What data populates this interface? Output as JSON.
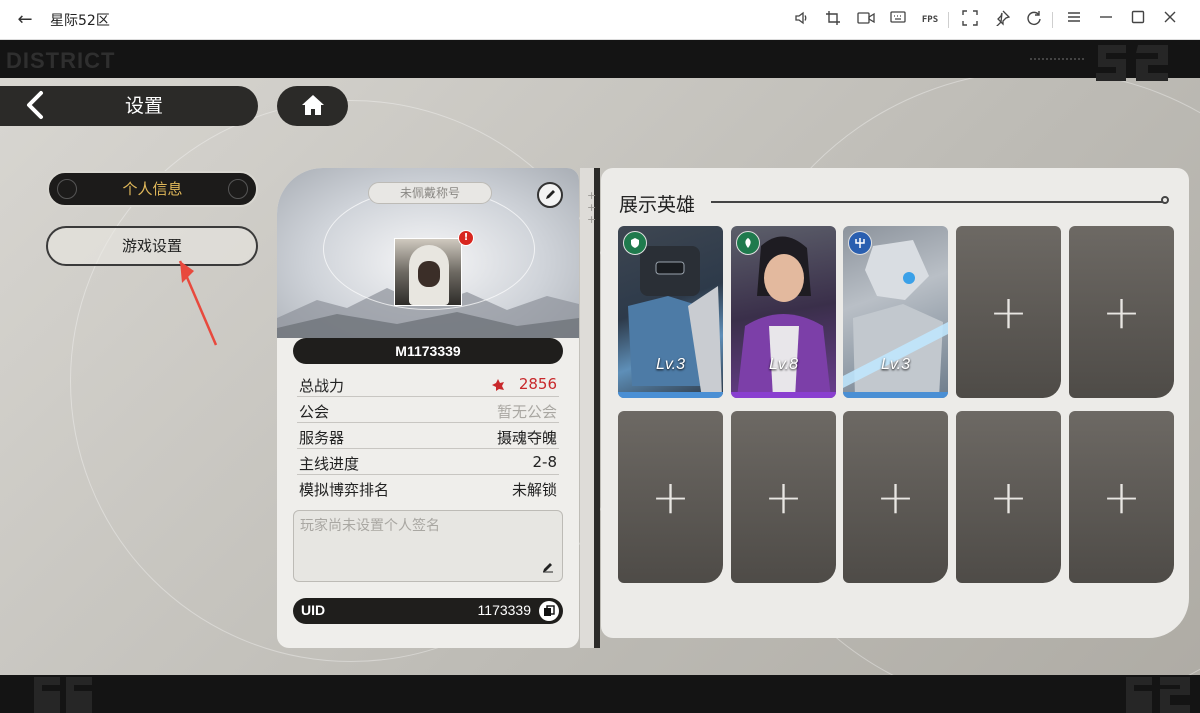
{
  "window": {
    "title": "星际52区",
    "back_icon": "back-arrow-icon",
    "toolbar_icons": [
      "volume-icon",
      "crop-icon",
      "record-icon",
      "keyboard-icon",
      "fps-icon",
      "fullscreen-icon",
      "pin-icon",
      "rotate-icon",
      "menu-icon",
      "minimize-icon",
      "maximize-icon",
      "close-icon"
    ],
    "fps_label": "FPS"
  },
  "game": {
    "district_text": "DISTRICT",
    "header": {
      "title": "设置",
      "back_icon": "chevron-left-icon",
      "home_icon": "home-icon"
    },
    "menu": {
      "items": [
        {
          "label": "个人信息",
          "active": true
        },
        {
          "label": "游戏设置",
          "active": false
        }
      ]
    },
    "profile": {
      "title_badge": "未佩戴称号",
      "edit_icon": "pencil-icon",
      "alert_mark": "!",
      "player_name": "M1173339",
      "stats": [
        {
          "label": "总战力",
          "value": "2856",
          "color": "#c8282b"
        },
        {
          "label": "公会",
          "value": "暂无公会",
          "color": "#a9a7a2"
        },
        {
          "label": "服务器",
          "value": "摄魂夺魄",
          "color": "#222222"
        },
        {
          "label": "主线进度",
          "value": "2-8",
          "color": "#222222"
        },
        {
          "label": "模拟博弈排名",
          "value": "未解锁",
          "color": "#222222"
        }
      ],
      "signature_placeholder": "玩家尚未设置个人签名",
      "uid_label": "UID",
      "uid_value": "1173339"
    },
    "heroes": {
      "title": "展示英雄",
      "slots": [
        {
          "filled": true,
          "level": "Lv.3",
          "faction_icon": "shield-faction-icon",
          "rarity_color": "#4a8fd4"
        },
        {
          "filled": true,
          "level": "Lv.8",
          "faction_icon": "leaf-faction-icon",
          "rarity_color": "#8a3fd0"
        },
        {
          "filled": true,
          "level": "Lv.3",
          "faction_icon": "trident-faction-icon",
          "rarity_color": "#4a8fd4"
        },
        {
          "filled": false
        },
        {
          "filled": false
        },
        {
          "filled": false
        },
        {
          "filled": false
        },
        {
          "filled": false
        },
        {
          "filled": false
        },
        {
          "filled": false
        }
      ]
    },
    "accent_colors": {
      "menu_active": "#e0b85a",
      "power": "#c8282b",
      "annotation_arrow": "#e8493d"
    }
  }
}
